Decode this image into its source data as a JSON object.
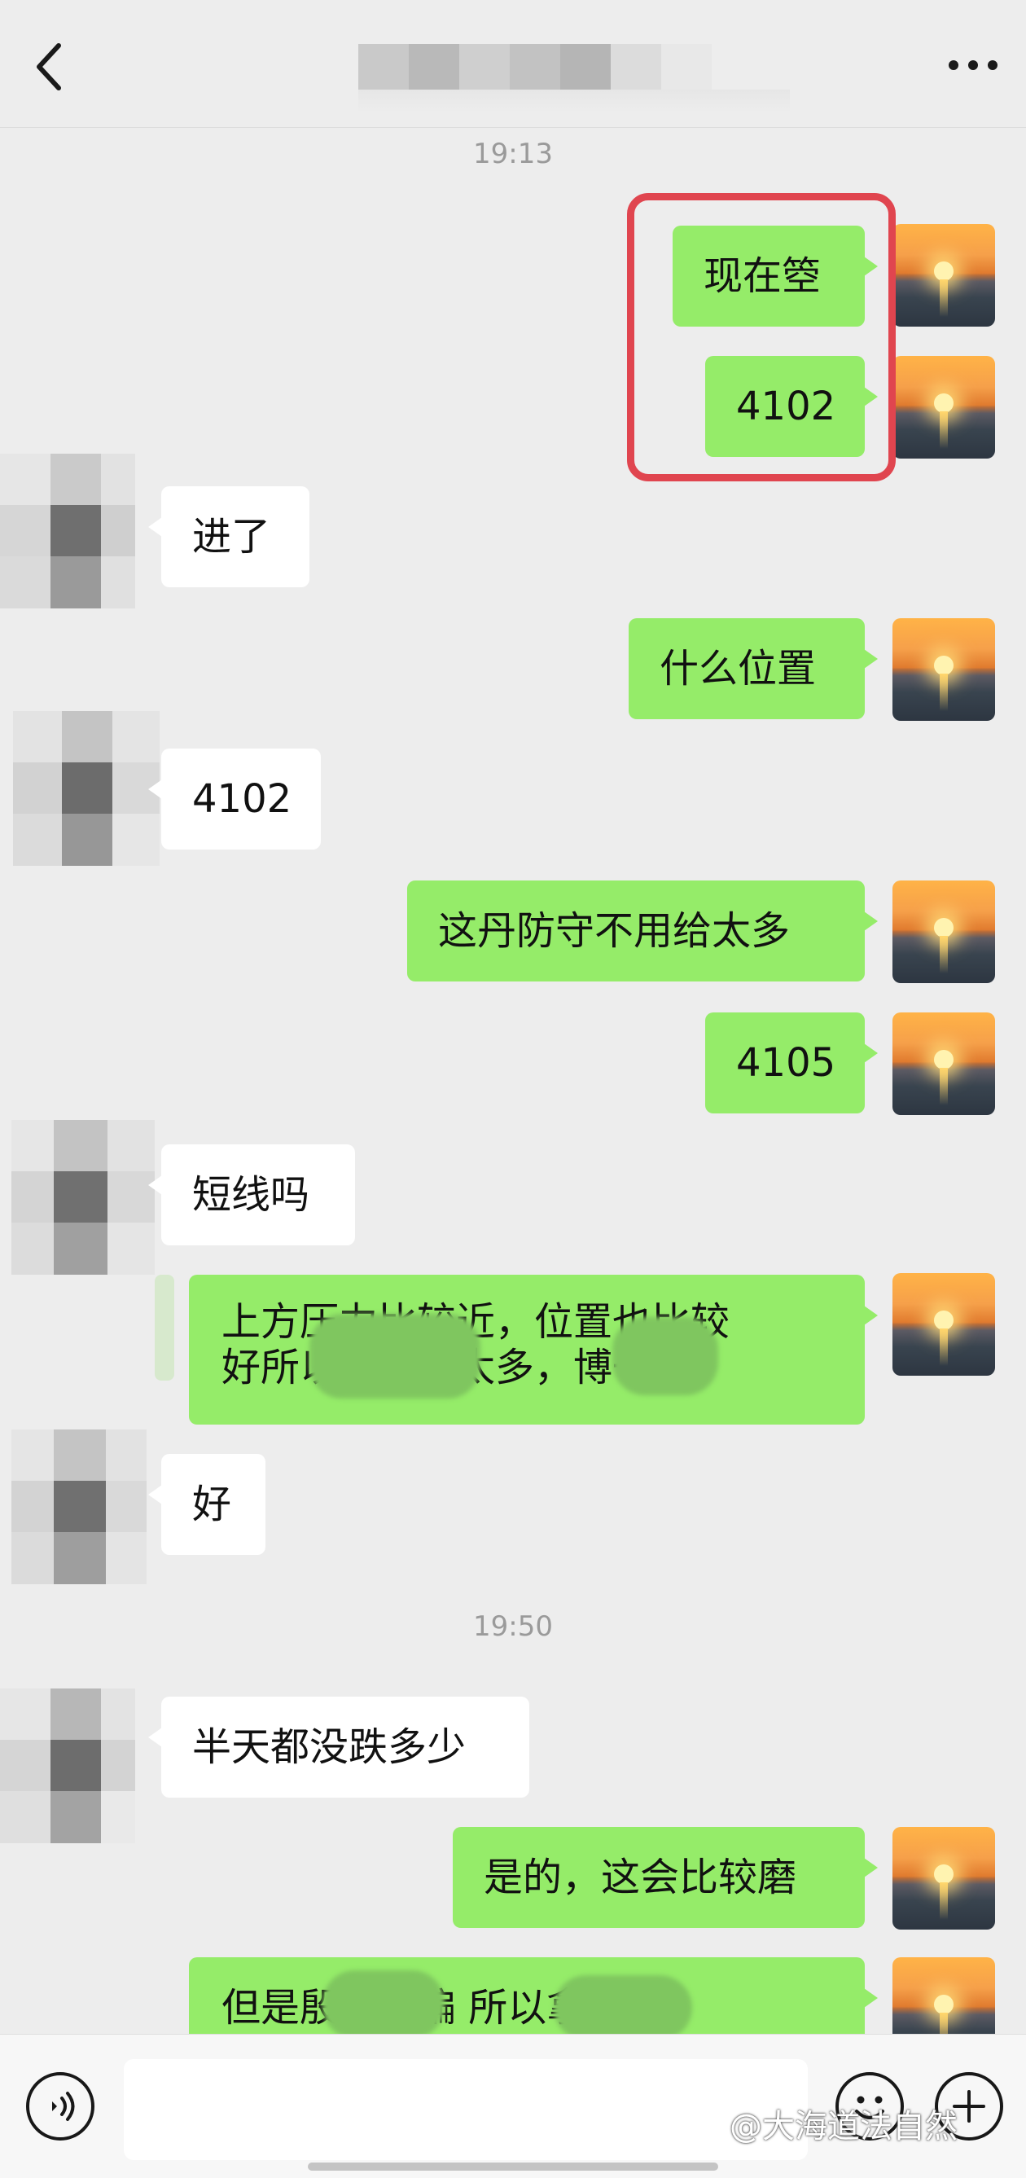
{
  "timestamps": [
    "19:13",
    "19:50"
  ],
  "messages": {
    "m1": "现在箜",
    "m2": "4102",
    "m3": "进了",
    "m4": "什么位置",
    "m5": "4102",
    "m6": "这丹防守不用给太多",
    "m7": "4105",
    "m8": "短线吗",
    "m9_line1": "上方压力比较近，位置也比较",
    "m9_line2": "好所以不用给太多，博一下",
    "m10": "好",
    "m11": "半天都没跌多少",
    "m12": "是的，这会比较磨",
    "m13": "但是殷显是偏 所以拿"
  },
  "watermark": "@大海道法自然",
  "colors": {
    "sent_bubble": "#95ec69",
    "recv_bubble": "#ffffff",
    "background": "#ededed",
    "highlight": "#e0454f"
  },
  "icons": {
    "back": "chevron-left-icon",
    "more": "more-dots-icon",
    "voice": "voice-icon",
    "emoji": "emoji-icon",
    "plus": "plus-icon"
  }
}
